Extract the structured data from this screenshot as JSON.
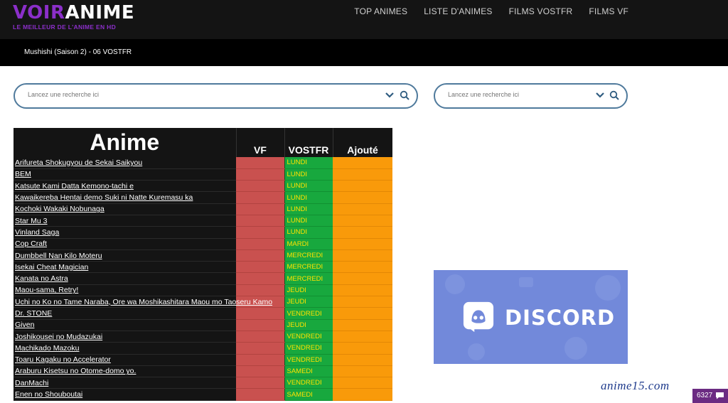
{
  "logo": {
    "part1": "VOIR",
    "part2": "ANIME",
    "tagline": "LE MEILLEUR DE L'ANIME EN HD"
  },
  "nav": [
    "TOP ANIMES",
    "LISTE D'ANIMES",
    "FILMS VOSTFR",
    "FILMS VF"
  ],
  "breadcrumb": "Mushishi (Saison 2) - 06 VOSTFR",
  "search_main": {
    "placeholder": "Lancez une recherche ici"
  },
  "search_side": {
    "placeholder": "Lancez une recherche ici"
  },
  "table": {
    "headers": {
      "anime": "Anime",
      "vf": "VF",
      "vostfr": "VOSTFR",
      "ajoute": "Ajouté"
    },
    "rows": [
      {
        "title": "Arifureta Shokugyou de Sekai Saikyou",
        "vostfr": "LUNDI"
      },
      {
        "title": "BEM",
        "vostfr": "LUNDI"
      },
      {
        "title": "Katsute Kami Datta Kemono-tachi e",
        "vostfr": "LUNDI"
      },
      {
        "title": "Kawaikereba Hentai demo Suki ni Natte Kuremasu ka",
        "vostfr": "LUNDI"
      },
      {
        "title": "Kochoki Wakaki Nobunaga",
        "vostfr": "LUNDI"
      },
      {
        "title": "Star Mu 3",
        "vostfr": "LUNDI"
      },
      {
        "title": "Vinland Saga",
        "vostfr": "LUNDI"
      },
      {
        "title": "Cop Craft",
        "vostfr": "MARDI"
      },
      {
        "title": "Dumbbell Nan Kilo Moteru",
        "vostfr": "MERCREDI"
      },
      {
        "title": "Isekai Cheat Magician",
        "vostfr": "MERCREDI"
      },
      {
        "title": "Kanata no Astra",
        "vostfr": "MERCREDI"
      },
      {
        "title": "Maou-sama, Retry!",
        "vostfr": "JEUDI"
      },
      {
        "title": "Uchi no Ko no Tame Naraba, Ore wa Moshikashitara Maou mo Taoseru Kamo",
        "vostfr": "JEUDI"
      },
      {
        "title": "Dr. STONE",
        "vostfr": "VENDREDI"
      },
      {
        "title": "Given",
        "vostfr": "JEUDI"
      },
      {
        "title": "Joshikousei no Mudazukai",
        "vostfr": "VENDREDI"
      },
      {
        "title": "Machikado Mazoku",
        "vostfr": "VENDREDI"
      },
      {
        "title": "Toaru Kagaku no Accelerator",
        "vostfr": "VENDREDI"
      },
      {
        "title": "Araburu Kisetsu no Otome-domo yo.",
        "vostfr": "SAMEDI"
      },
      {
        "title": "DanMachi",
        "vostfr": "VENDREDI"
      },
      {
        "title": "Enen no Shouboutai",
        "vostfr": "SAMEDI"
      }
    ]
  },
  "discord": {
    "label": "DISCORD",
    "color": "#7289da"
  },
  "watermark": "anime15.com",
  "badge": {
    "count": "6327"
  },
  "colors": {
    "accent": "#8b2fc9",
    "vf": "#c9514f",
    "vostfr": "#18a83e",
    "ajoute": "#f99a0a"
  }
}
